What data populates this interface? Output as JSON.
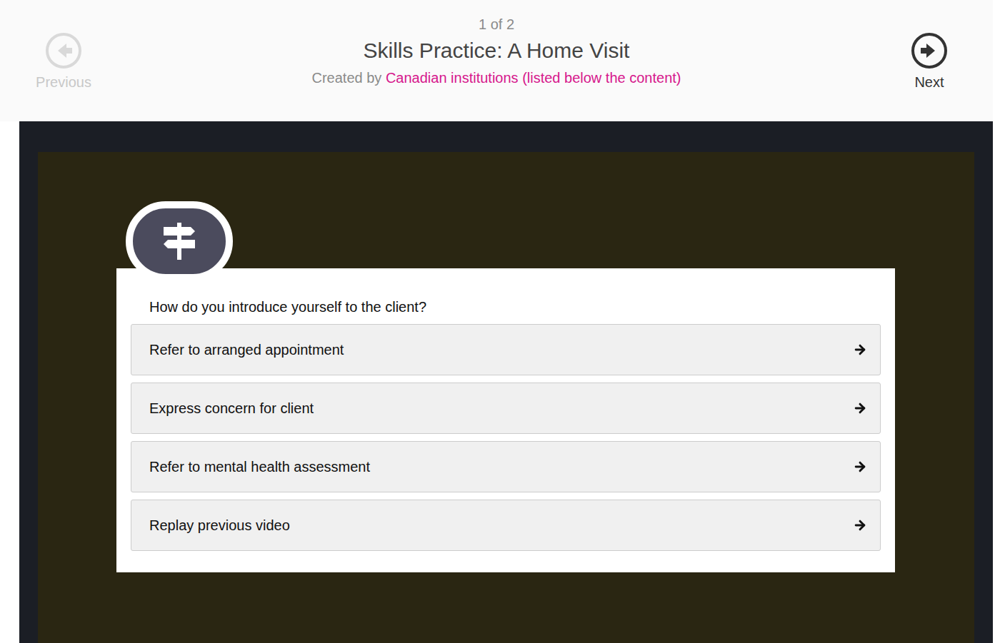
{
  "header": {
    "counter": "1 of 2",
    "title": "Skills Practice: A Home Visit",
    "created_by_label": "Created by",
    "created_by_link": "Canadian institutions (listed below the content)"
  },
  "nav": {
    "previous": {
      "label": "Previous",
      "disabled": true
    },
    "next": {
      "label": "Next",
      "disabled": false
    }
  },
  "question": {
    "prompt": "How do you introduce yourself to the client?",
    "options": [
      {
        "label": "Refer to arranged appointment"
      },
      {
        "label": "Express concern for client"
      },
      {
        "label": "Refer to mental health assessment"
      },
      {
        "label": "Replay previous video"
      }
    ]
  }
}
